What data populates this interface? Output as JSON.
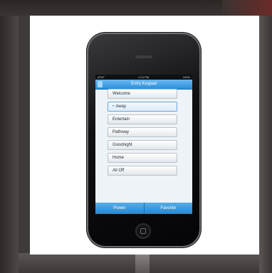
{
  "status_bar": {
    "carrier": "AT&T",
    "time": "4:21 PM",
    "battery": "100%"
  },
  "nav": {
    "title": "Entry Keypad"
  },
  "list": {
    "items": [
      {
        "label": "Welcome",
        "selected": false
      },
      {
        "label": "Away",
        "selected": true
      },
      {
        "label": "Entertain",
        "selected": false
      },
      {
        "label": "Pathway",
        "selected": false
      },
      {
        "label": "Goodnight",
        "selected": false
      },
      {
        "label": "Home",
        "selected": false
      },
      {
        "label": "All Off",
        "selected": false
      }
    ],
    "selected_marker": "•"
  },
  "tabs": [
    {
      "label": "Power"
    },
    {
      "label": "Favorite"
    }
  ],
  "colors": {
    "nav_blue": "#2c8fda",
    "tab_blue": "#2a86cd",
    "screen_bg": "#eef3f7"
  }
}
